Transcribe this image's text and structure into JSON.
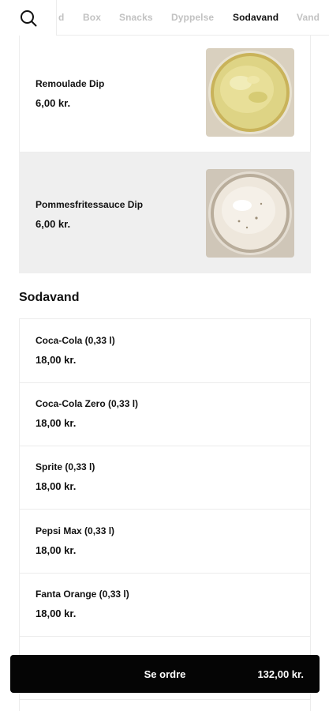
{
  "category_tabs": [
    {
      "label": "d",
      "active": false
    },
    {
      "label": "Box",
      "active": false
    },
    {
      "label": "Snacks",
      "active": false
    },
    {
      "label": "Dyppelse",
      "active": false
    },
    {
      "label": "Sodavand",
      "active": true
    },
    {
      "label": "Vand",
      "active": false
    }
  ],
  "featured_products": [
    {
      "name": "Remoulade Dip",
      "price": "6,00 kr.",
      "image_icon": "remoulade-dip-photo"
    },
    {
      "name": "Pommesfritessauce Dip",
      "price": "6,00 kr.",
      "image_icon": "fries-sauce-dip-photo"
    }
  ],
  "section": {
    "title": "Sodavand",
    "items": [
      {
        "name": "Coca-Cola (0,33 l)",
        "price": "18,00 kr."
      },
      {
        "name": "Coca-Cola Zero (0,33 l)",
        "price": "18,00 kr."
      },
      {
        "name": "Sprite (0,33 l)",
        "price": "18,00 kr."
      },
      {
        "name": "Pepsi Max (0,33 l)",
        "price": "18,00 kr."
      },
      {
        "name": "Fanta Orange (0,33 l)",
        "price": "18,00 kr."
      }
    ]
  },
  "order_bar": {
    "label": "Se ordre",
    "total": "132,00 kr."
  },
  "icons": {
    "search": "search-icon"
  },
  "colors": {
    "accent": "#050505",
    "inactive_tab": "#c2c2c2",
    "selected_card_bg": "#efefef"
  }
}
